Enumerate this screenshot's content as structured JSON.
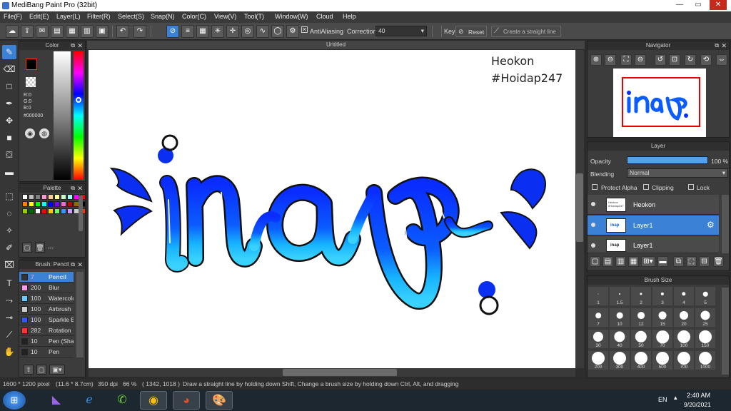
{
  "window": {
    "title": "MediBang Paint Pro (32bit)",
    "min": "—",
    "max": "▭",
    "close": "✕"
  },
  "menu": [
    "File(F)",
    "Edit(E)",
    "Layer(L)",
    "Filter(R)",
    "Select(S)",
    "Snap(N)",
    "Color(C)",
    "View(V)",
    "Tool(T)",
    "Window(W)",
    "Cloud",
    "Help"
  ],
  "toolbar": {
    "antialiasing_label": "AntiAliasing",
    "correction_label": "Correction",
    "correction_value": "40",
    "key_label": "Key",
    "reset_label": "Reset",
    "straight_line_label": "Create a straight line"
  },
  "color_panel": {
    "title": "Color",
    "r": "R:0",
    "g": "G:0",
    "b": "B:0",
    "hex": "#000000"
  },
  "palette_panel": {
    "title": "Palette",
    "colors": [
      "#ffffff",
      "#c0c0c0",
      "#808080",
      "#ff99cc",
      "#ffcc99",
      "#ffff99",
      "#ccffcc",
      "#99ffff",
      "#ff00ff",
      "#ff0000",
      "#ff8000",
      "#ffff00",
      "#00ff00",
      "#00ffff",
      "#0000ff",
      "#8000ff",
      "#ff66cc",
      "#cc0000",
      "#996600",
      "#000000",
      "#99cc00",
      "#006600",
      "#ffffff",
      "#ff0000",
      "#ffcc00",
      "#66ff66",
      "#3399ff",
      "#cc99ff",
      "#cccccc",
      "#ff3300"
    ],
    "dash": "---"
  },
  "brush_panel": {
    "title": "Brush: Pencil",
    "brushes": [
      {
        "size": "7",
        "name": "Pencil",
        "color": "#333333"
      },
      {
        "size": "200",
        "name": "Blur",
        "color": "#ff99ee"
      },
      {
        "size": "100",
        "name": "Watercolor",
        "color": "#66ccff"
      },
      {
        "size": "100",
        "name": "Airbrush",
        "color": "#cccccc"
      },
      {
        "size": "100",
        "name": "Sparkle Brush",
        "color": "#3355ff"
      },
      {
        "size": "282",
        "name": "Rotation",
        "color": "#ff3333"
      },
      {
        "size": "10",
        "name": "Pen (Sharp)",
        "color": "#222222"
      },
      {
        "size": "10",
        "name": "Pen",
        "color": "#222222"
      }
    ]
  },
  "canvas": {
    "tab_title": "Untitled",
    "text_line1": "Heokon",
    "text_line2": "#Hoidap247",
    "artwork_word": "inap"
  },
  "navigator": {
    "title": "Navigator"
  },
  "layer_panel": {
    "title": "Layer",
    "opacity_label": "Opacity",
    "opacity_value": "100 %",
    "opacity_fraction": 1.0,
    "blending_label": "Blending",
    "blending_value": "Normal",
    "protect_alpha": "Protect Alpha",
    "clipping": "Clipping",
    "lock": "Lock",
    "layers": [
      {
        "name": "Heokon",
        "thumb": "Heokon #Hoidap247"
      },
      {
        "name": "Layer1",
        "thumb": "inap"
      },
      {
        "name": "Layer1",
        "thumb": "inap"
      }
    ]
  },
  "brush_size_panel": {
    "title": "Brush Size",
    "sizes": [
      "1",
      "1.5",
      "2",
      "3",
      "4",
      "5",
      "7",
      "10",
      "12",
      "15",
      "20",
      "25",
      "30",
      "40",
      "50",
      "70",
      "100",
      "150",
      "200",
      "300",
      "400",
      "500",
      "700",
      "1000"
    ]
  },
  "status": {
    "dimensions": "1600 * 1200 pixel",
    "physical": "(11.6 * 8.7cm)",
    "dpi": "350 dpi",
    "zoom": "66 %",
    "cursor": "( 1342, 1018 )",
    "hint": "Draw a straight line by holding down Shift, Change a brush size by holding down Ctrl, Alt, and dragging"
  },
  "taskbar": {
    "lang": "EN",
    "time": "2:40 AM",
    "date": "9/20/2021"
  }
}
